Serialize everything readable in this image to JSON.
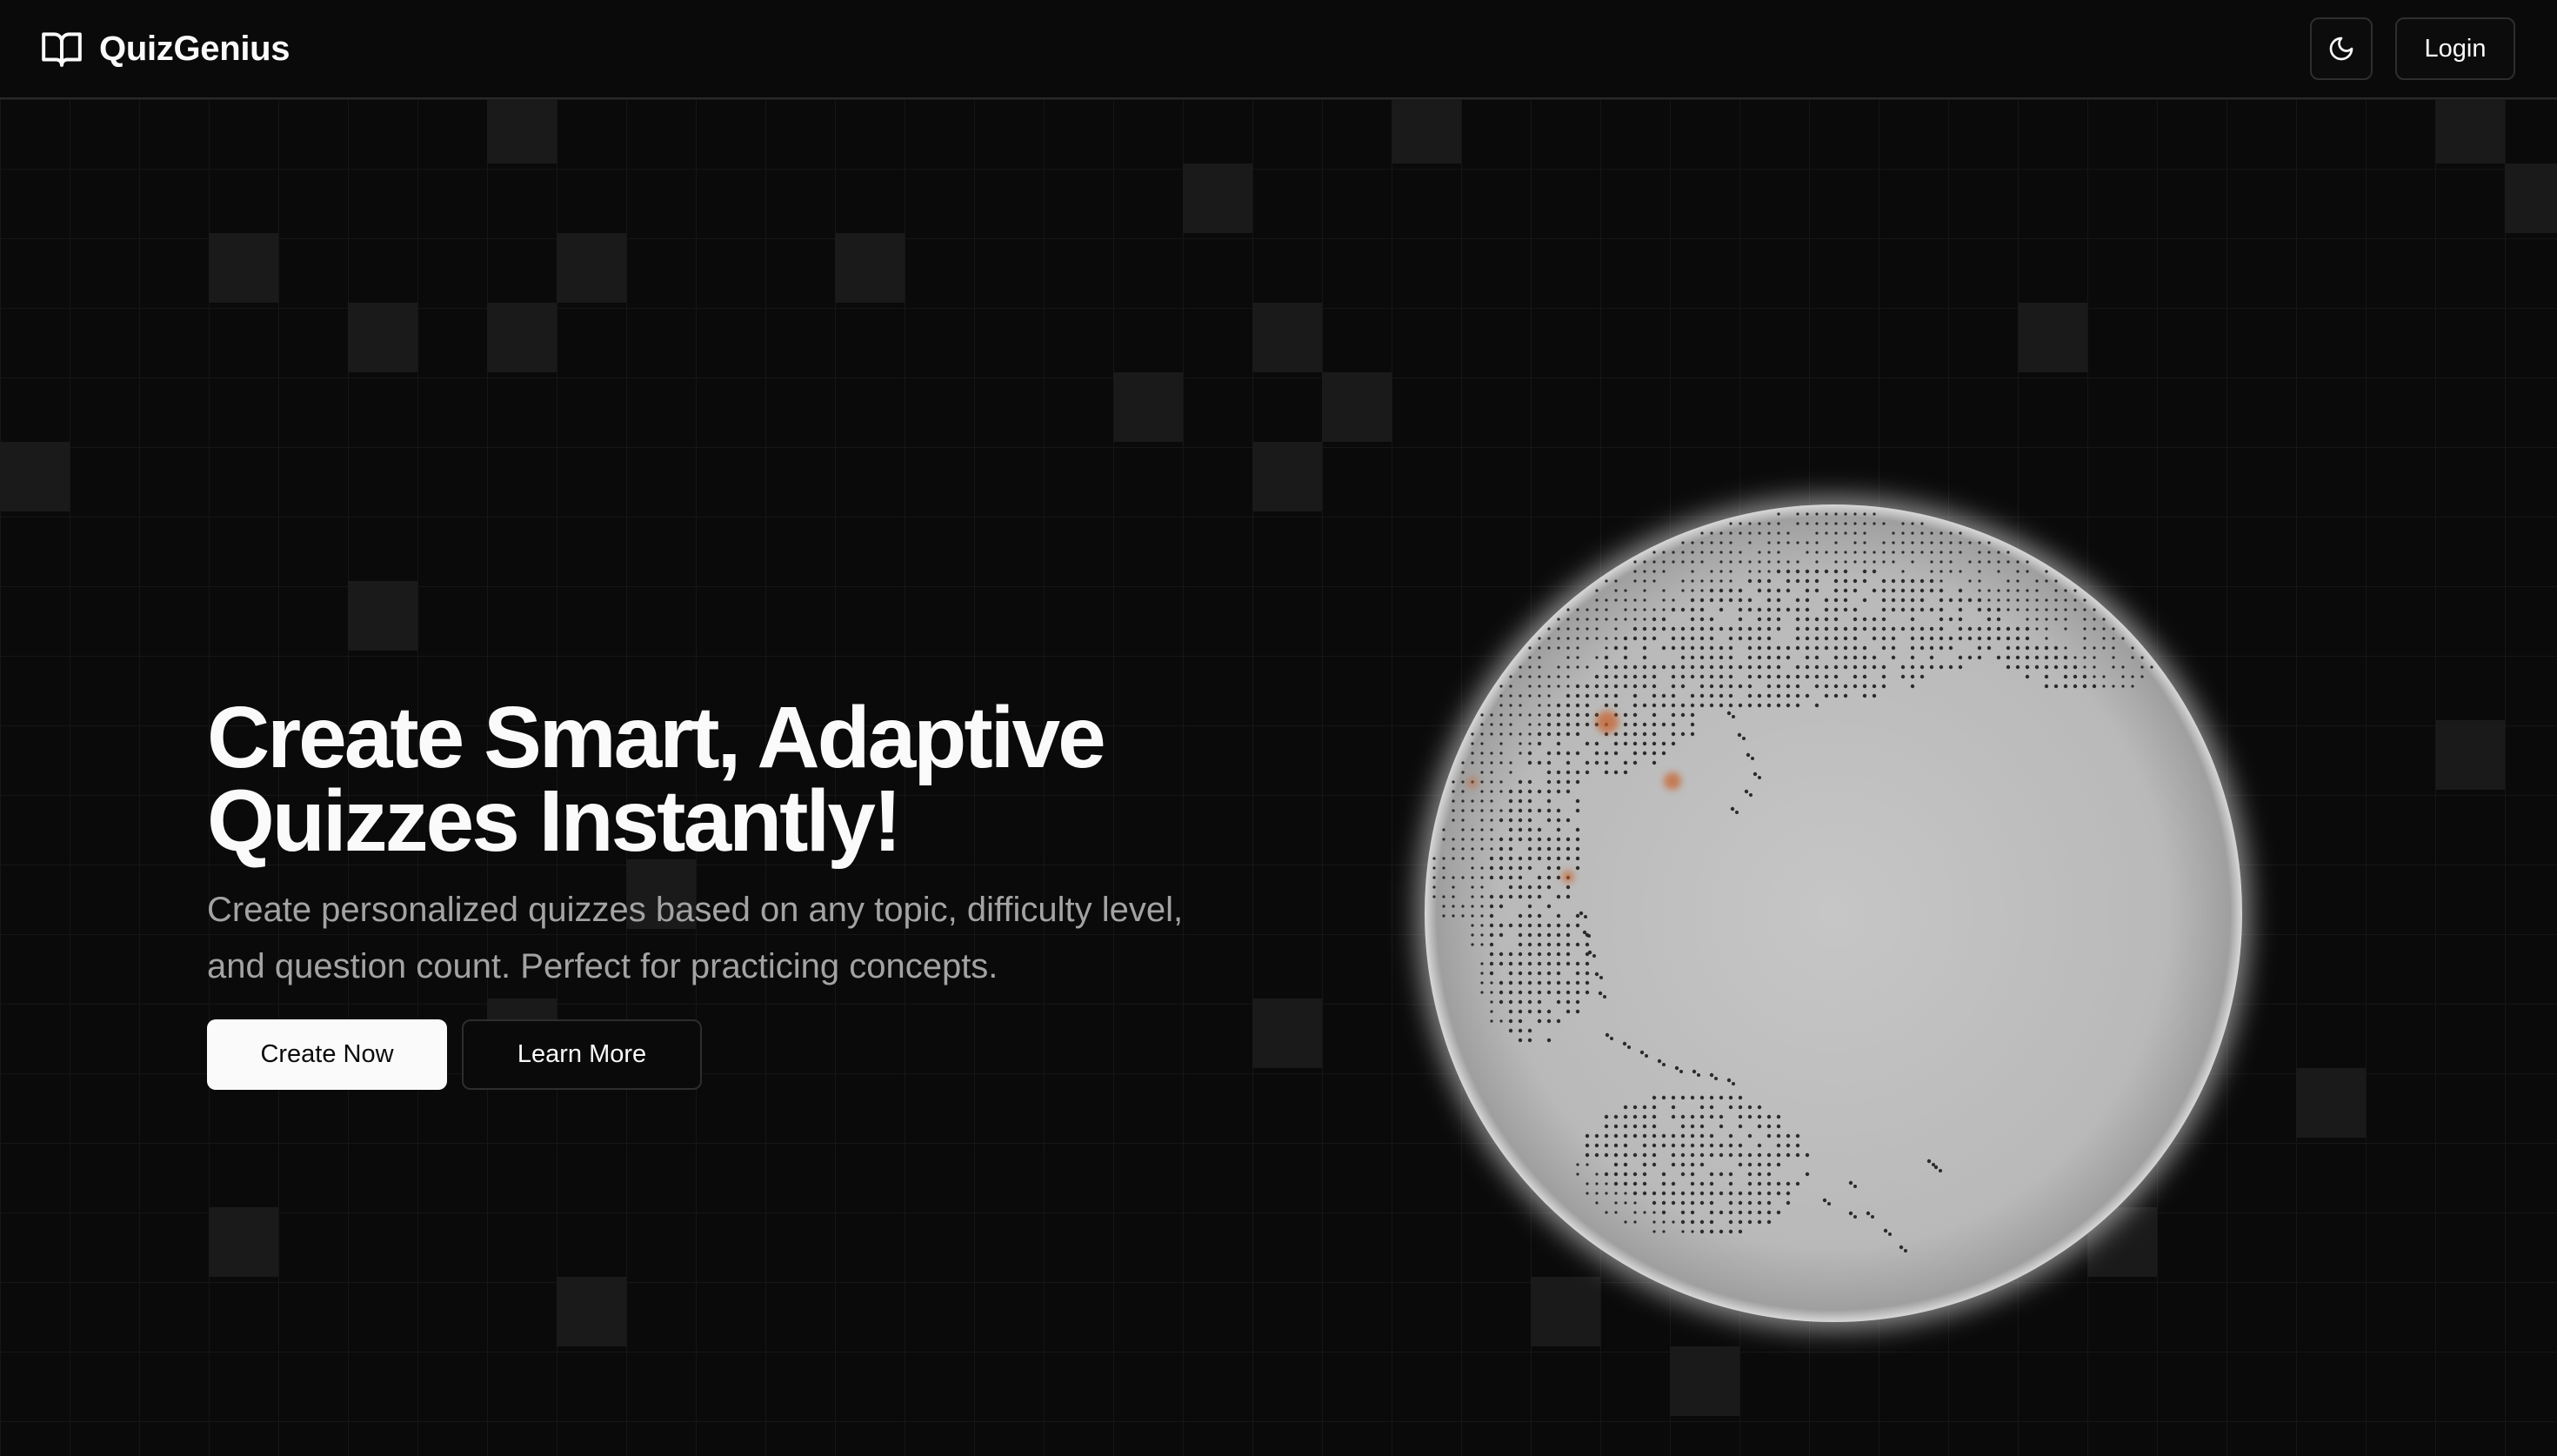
{
  "header": {
    "brand": "QuizGenius",
    "brand_icon": "open-book-icon",
    "theme_toggle_icon": "moon-icon",
    "login_label": "Login"
  },
  "hero": {
    "title_line1": "Create Smart, Adaptive",
    "title_line2": "Quizzes Instantly!",
    "subtitle": "Create personalized quizzes based on any topic, difficulty level, and question count. Perfect for practicing concepts.",
    "primary_button": "Create Now",
    "secondary_button": "Learn More"
  },
  "globe": {
    "icon": "globe-graphic",
    "land_dot_color": "#2b2b2b",
    "marker_color": "#c8642e",
    "surface_color": "#bdbdbd"
  },
  "colors": {
    "background": "#0a0a0a",
    "text_primary": "#fafafa",
    "text_muted": "#a3a3a3",
    "border": "#2e2e2e"
  }
}
